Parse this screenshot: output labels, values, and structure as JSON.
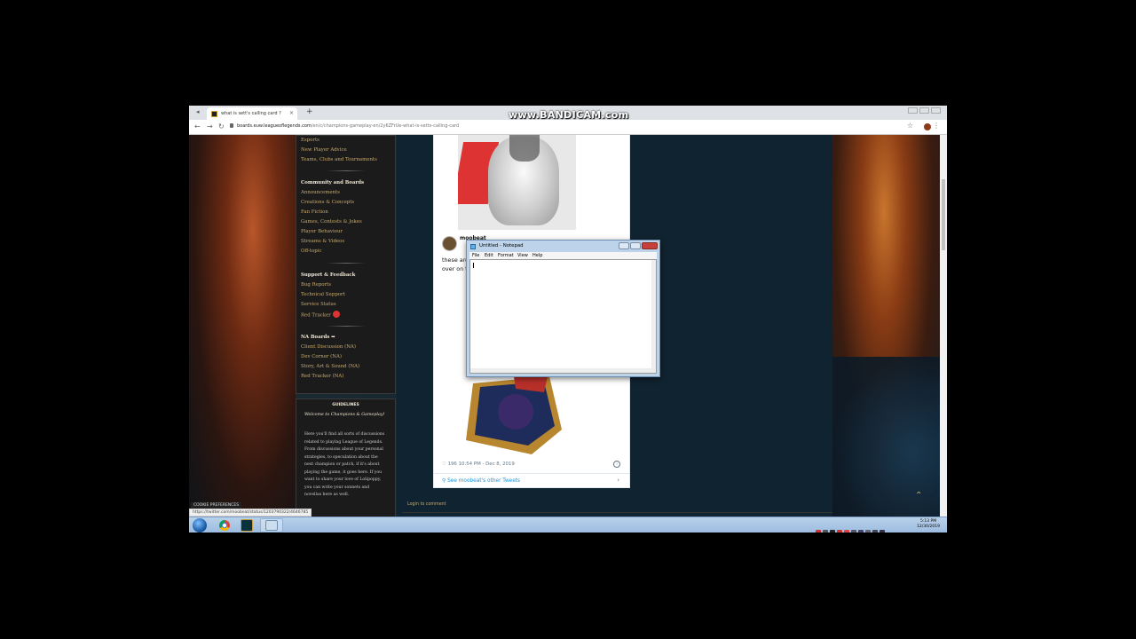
{
  "browser": {
    "tab_title": "what is sett's calling card ?",
    "tab_close": "×",
    "new_tab": "+",
    "url_host": "boards.euw.leagueoflegends.com",
    "url_path": "/en/c/champions-gameplay-en/2y6ZFrUe-what-is-setts-calling-card",
    "watermark": "www.BANDICAM.com"
  },
  "sidebar": {
    "links_top": [
      "Esports",
      "New Player Advice",
      "Teams, Clubs and Tournaments"
    ],
    "community_header": "Community and Boards",
    "community_links": [
      "Announcements",
      "Creations & Concepts",
      "Fan Fiction",
      "Games, Contests & Jokes",
      "Player Behaviour",
      "Streams & Videos",
      "Off-topic"
    ],
    "support_header": "Support & Feedback",
    "support_links": [
      "Bug Reports",
      "Technical Support",
      "Service Status",
      "Red Tracker"
    ],
    "na_header": "NA Boards ➡",
    "na_links": [
      "Client Discussion (NA)",
      "Dev Corner (NA)",
      "Story, Art & Sound (NA)",
      "Red Tracker (NA)"
    ]
  },
  "guidelines": {
    "heading": "GUIDELINES",
    "welcome": "Welcome to Champions & Gameplay!",
    "body": "Here you'll find all sorts of discussions related to playing League of Legends. From discussions about your personal strategies, to speculation about the next champion or patch, if it's about playing the game, it goes here. If you want to share your love of Lolipoppy, you can write your sonnets and novellas here as well."
  },
  "tweet": {
    "author": "moobeat",
    "text": "these are\nover on t",
    "likes": "196",
    "time": "10:54 PM - Dec 8, 2019",
    "other_tweets": "See moobeat's other Tweets"
  },
  "page": {
    "login": "Login to comment",
    "cookie": "COOKIE PREFERENCES",
    "status_url": "https://twitter.com/moobeat/status/1203790322/4646785"
  },
  "notepad": {
    "title": "Untitled - Notepad",
    "menu": [
      "File",
      "Edit",
      "Format",
      "View",
      "Help"
    ]
  },
  "taskbar": {
    "time": "5:13 PM",
    "date": "12/30/2019"
  },
  "colors": {
    "gold_link": "#c8aa6e",
    "gold_text": "#f0e6d2",
    "twitter_blue": "#1b95e0"
  }
}
